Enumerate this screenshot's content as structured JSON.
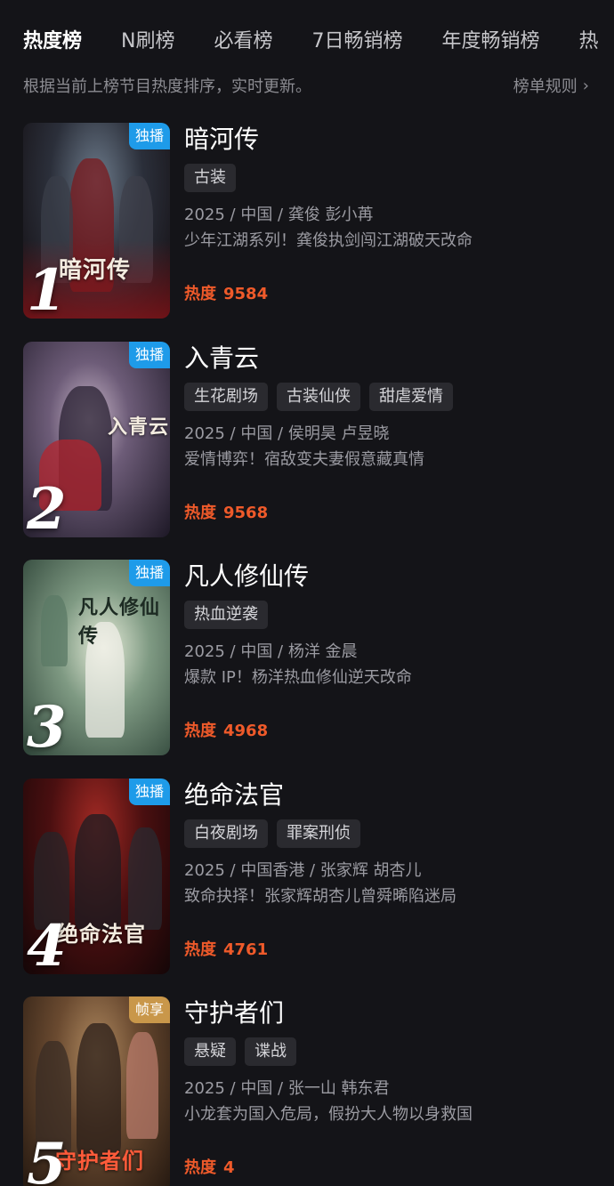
{
  "tabs": [
    "热度榜",
    "N刷榜",
    "必看榜",
    "7日畅销榜",
    "年度畅销榜",
    "热"
  ],
  "subtitle": "根据当前上榜节目热度排序，实时更新。",
  "rules_label": "榜单规则",
  "heat_label": "热度",
  "items": [
    {
      "rank": "1",
      "badge": "独播",
      "badge_color": "#1e9be9",
      "poster_title": "暗河传",
      "title": "暗河传",
      "tags": [
        "古装"
      ],
      "meta": "2025 / 中国 / 龚俊 彭小苒",
      "desc": "少年江湖系列！龚俊执剑闯江湖破天改命",
      "heat": "9584"
    },
    {
      "rank": "2",
      "badge": "独播",
      "badge_color": "#1e9be9",
      "poster_title": "入青云",
      "title": "入青云",
      "tags": [
        "生花剧场",
        "古装仙侠",
        "甜虐爱情"
      ],
      "meta": "2025 / 中国 / 侯明昊 卢昱晓",
      "desc": "爱情博弈！宿敌变夫妻假意藏真情",
      "heat": "9568"
    },
    {
      "rank": "3",
      "badge": "独播",
      "badge_color": "#1e9be9",
      "poster_title": "凡人修仙传",
      "title": "凡人修仙传",
      "tags": [
        "热血逆袭"
      ],
      "meta": "2025 / 中国 / 杨洋 金晨",
      "desc": "爆款 IP！杨洋热血修仙逆天改命",
      "heat": "4968"
    },
    {
      "rank": "4",
      "badge": "独播",
      "badge_color": "#1e9be9",
      "poster_title": "绝命法官",
      "title": "绝命法官",
      "tags": [
        "白夜剧场",
        "罪案刑侦"
      ],
      "meta": "2025 / 中国香港 / 张家辉 胡杏儿",
      "desc": "致命抉择！张家辉胡杏儿曾舜晞陷迷局",
      "heat": "4761"
    },
    {
      "rank": "5",
      "badge": "帧享",
      "badge_color": "#c9974a",
      "poster_title": "守护者们",
      "title": "守护者们",
      "tags": [
        "悬疑",
        "谍战"
      ],
      "meta": "2025 / 中国 / 张一山 韩东君",
      "desc": "小龙套为国入危局，假扮大人物以身救国",
      "heat": "4"
    }
  ]
}
